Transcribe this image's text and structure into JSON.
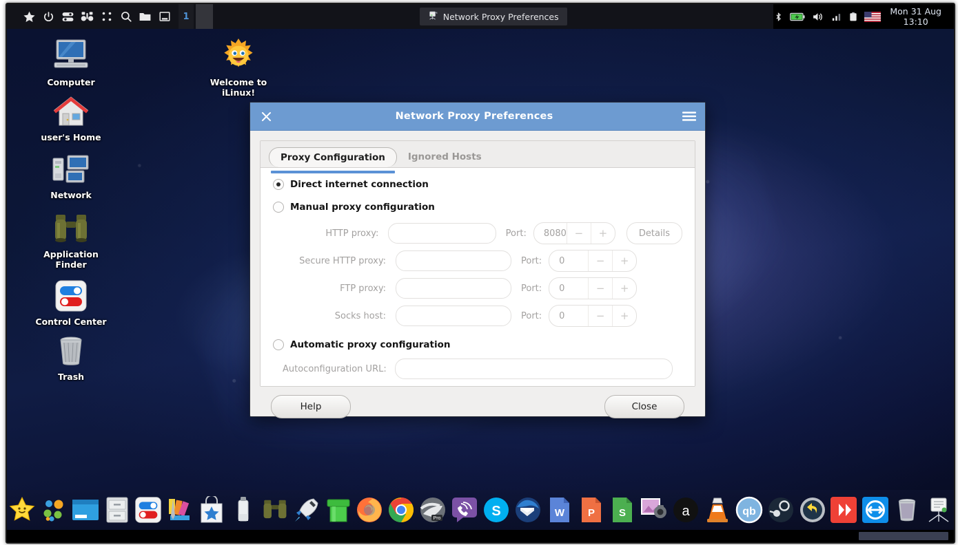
{
  "panel": {
    "launcher_icons": [
      {
        "name": "star-icon",
        "label": "Applications Menu"
      },
      {
        "name": "power-icon",
        "label": "Power"
      },
      {
        "name": "settings-toggle-icon",
        "label": "Settings"
      },
      {
        "name": "binoculars-icon",
        "label": "Application Finder"
      },
      {
        "name": "grid-apps-icon",
        "label": "Applications"
      },
      {
        "name": "search-icon",
        "label": "Search"
      },
      {
        "name": "folder-icon",
        "label": "File Manager"
      },
      {
        "name": "window-icon",
        "label": "Show Desktop"
      }
    ],
    "workspace": "1",
    "task_title": "Network Proxy Preferences",
    "tray_icons": [
      {
        "name": "bluetooth-icon"
      },
      {
        "name": "battery-icon"
      },
      {
        "name": "volume-icon"
      },
      {
        "name": "network-signal-icon"
      },
      {
        "name": "clipboard-icon"
      },
      {
        "name": "keyboard-flag-icon"
      }
    ],
    "clock_date": "Mon 31 Aug",
    "clock_time": "13:10"
  },
  "desktop": {
    "icons": [
      {
        "label": "Computer",
        "icon": "computer-icon"
      },
      {
        "label": "Welcome to iLinux!",
        "icon": "sun-icon"
      },
      {
        "label": "user's Home",
        "icon": "home-folder-icon"
      },
      {
        "label": "Network",
        "icon": "network-icon"
      },
      {
        "label": "Application Finder",
        "icon": "binoculars-icon"
      },
      {
        "label": "Control Center",
        "icon": "control-center-icon"
      },
      {
        "label": "Trash",
        "icon": "trash-icon"
      }
    ]
  },
  "dialog": {
    "title": "Network Proxy Preferences",
    "close_icon": "close-icon",
    "menu_icon": "hamburger-menu-icon",
    "tabs": [
      {
        "label": "Proxy Configuration",
        "active": true
      },
      {
        "label": "Ignored Hosts",
        "active": false
      }
    ],
    "radios": [
      {
        "label": "Direct internet connection",
        "selected": true
      },
      {
        "label": "Manual proxy configuration",
        "selected": false
      },
      {
        "label": "Automatic proxy configuration",
        "selected": false
      }
    ],
    "proxy_rows": [
      {
        "label": "HTTP proxy:",
        "value": "",
        "port_label": "Port:",
        "port": "8080",
        "has_details": true
      },
      {
        "label": "Secure HTTP proxy:",
        "value": "",
        "port_label": "Port:",
        "port": "0",
        "has_details": false
      },
      {
        "label": "FTP proxy:",
        "value": "",
        "port_label": "Port:",
        "port": "0",
        "has_details": false
      },
      {
        "label": "Socks host:",
        "value": "",
        "port_label": "Port:",
        "port": "0",
        "has_details": false
      }
    ],
    "details_label": "Details",
    "spin_down": "−",
    "spin_up": "+",
    "autoconfig_label": "Autoconfiguration URL:",
    "autoconfig_value": "",
    "help_label": "Help",
    "close_label": "Close"
  },
  "dock": {
    "items": [
      {
        "name": "star-face-icon"
      },
      {
        "name": "bubbles-icon"
      },
      {
        "name": "terminal-window-icon"
      },
      {
        "name": "file-cabinet-icon"
      },
      {
        "name": "control-center-icon"
      },
      {
        "name": "color-palette-icon"
      },
      {
        "name": "app-store-icon"
      },
      {
        "name": "paint-tube-icon"
      },
      {
        "name": "binoculars-icon"
      },
      {
        "name": "rocket-icon"
      },
      {
        "name": "green-pipe-icon"
      },
      {
        "name": "firefox-icon"
      },
      {
        "name": "chrome-icon"
      },
      {
        "name": "opera-pro-icon"
      },
      {
        "name": "viber-icon"
      },
      {
        "name": "skype-icon"
      },
      {
        "name": "thunderbird-icon"
      },
      {
        "name": "word-processor-icon"
      },
      {
        "name": "presentation-icon"
      },
      {
        "name": "spreadsheet-icon"
      },
      {
        "name": "screenshot-icon"
      },
      {
        "name": "audacious-icon"
      },
      {
        "name": "vlc-icon"
      },
      {
        "name": "qbittorrent-icon"
      },
      {
        "name": "steam-icon"
      },
      {
        "name": "restore-icon"
      },
      {
        "name": "anydesk-icon"
      },
      {
        "name": "teamviewer-icon"
      },
      {
        "name": "trash-icon"
      },
      {
        "name": "network-config-icon"
      }
    ]
  },
  "colors": {
    "titlebar": "#6d9bd1",
    "tab_underline": "#5b91d6",
    "dialog_bg": "#f0efee",
    "panel_bg": "#121319",
    "workspace_accent": "#4f93d6"
  }
}
